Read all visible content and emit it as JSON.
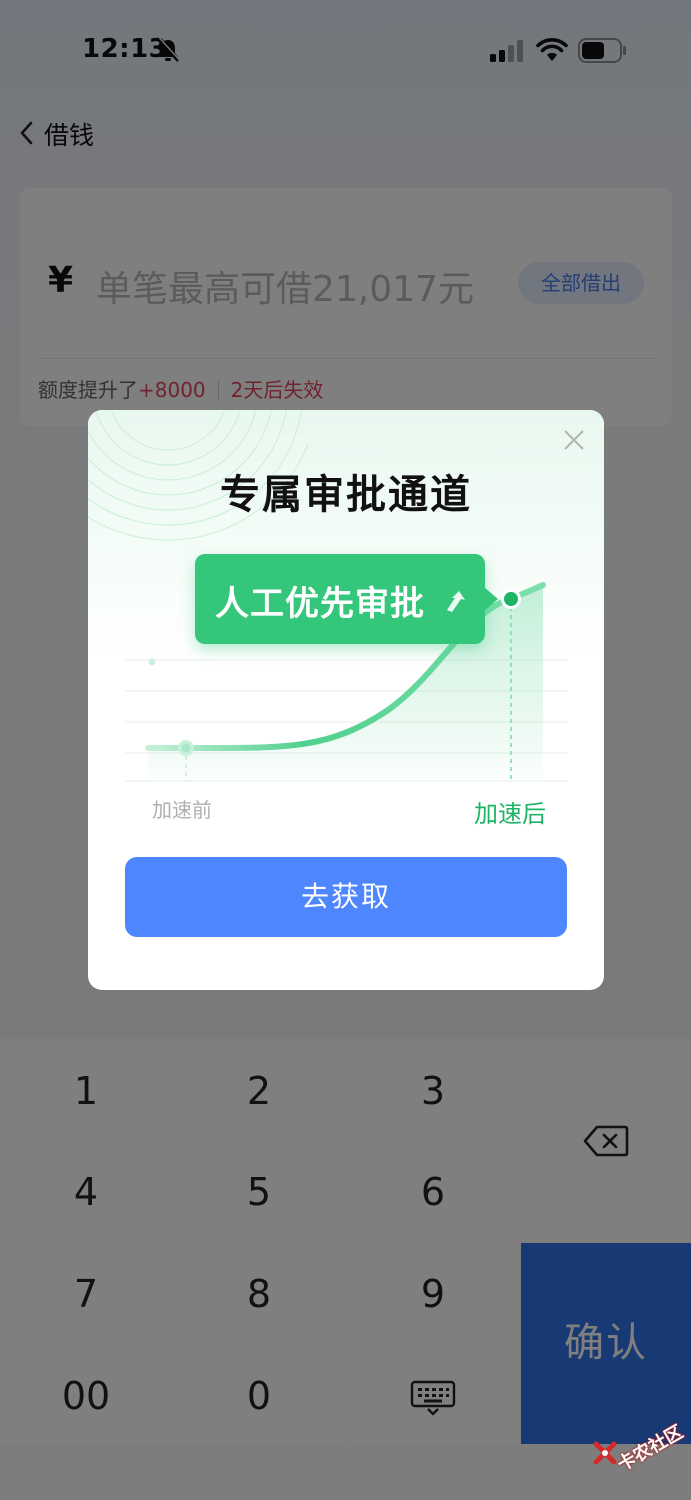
{
  "status_bar": {
    "time": "12:13"
  },
  "nav": {
    "title": "借钱"
  },
  "loan_card": {
    "currency_symbol": "¥",
    "amount_placeholder": "单笔最高可借21,017元",
    "borrow_all_label": "全部借出",
    "quota_prefix": "额度提升了",
    "quota_increase": "+8000",
    "expiry_text": "2天后失效"
  },
  "keypad": {
    "keys": [
      "1",
      "2",
      "3",
      "4",
      "5",
      "6",
      "7",
      "8",
      "9",
      "00",
      "0"
    ],
    "confirm_label": "确认"
  },
  "dialog": {
    "title": "专属审批通道",
    "tag_label": "人工优先审批",
    "before_label": "加速前",
    "after_label": "加速后",
    "action_label": "去获取"
  },
  "watermark": {
    "text": "卡农社区"
  },
  "colors": {
    "accent_blue": "#4e86ff",
    "accent_green": "#34c77b",
    "highlight_red": "#e0465b"
  }
}
